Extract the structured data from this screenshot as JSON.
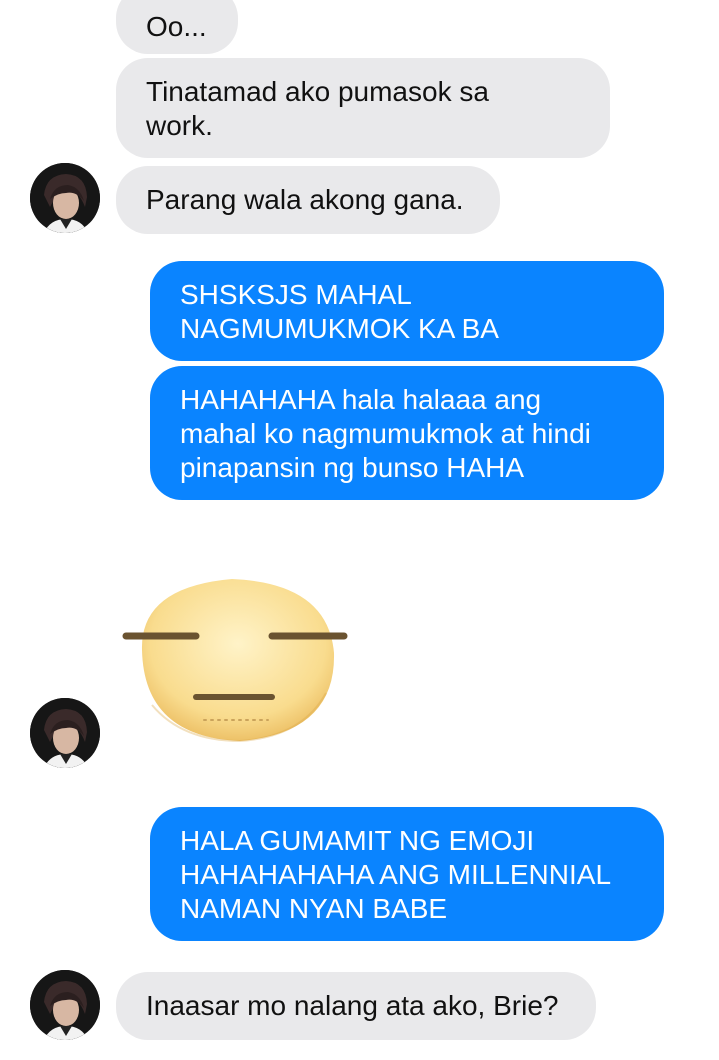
{
  "messages": [
    {
      "id": "m1",
      "side": "received",
      "text": "Oo..."
    },
    {
      "id": "m2",
      "side": "received",
      "text": "Tinatamad ako pumasok sa\nwork."
    },
    {
      "id": "m3",
      "side": "received",
      "text": "Parang wala akong gana."
    },
    {
      "id": "m4",
      "side": "sent",
      "text": "SHSKSJS MAHAL\nNAGMUMUKMOK KA BA"
    },
    {
      "id": "m5",
      "side": "sent",
      "text": "HAHAHAHA hala halaaa ang\nmahal ko nagmumukmok at hindi\npinapansin ng bunso HAHA"
    },
    {
      "id": "m6",
      "side": "received",
      "type": "sticker",
      "sticker": "expressionless-face"
    },
    {
      "id": "m7",
      "side": "sent",
      "text": "HALA GUMAMIT NG EMOJI\nHAHAHAHAHA ANG MILLENNIAL\nNAMAN NYAN BABE"
    },
    {
      "id": "m8",
      "side": "received",
      "text": "Inaasar mo nalang ata ako, Brie?"
    }
  ],
  "colors": {
    "sent_bubble": "#0a84ff",
    "received_bubble": "#e9e9eb",
    "sent_text": "#ffffff",
    "received_text": "#111111",
    "background": "#ffffff"
  },
  "icons": {
    "avatar": "contact-avatar"
  }
}
